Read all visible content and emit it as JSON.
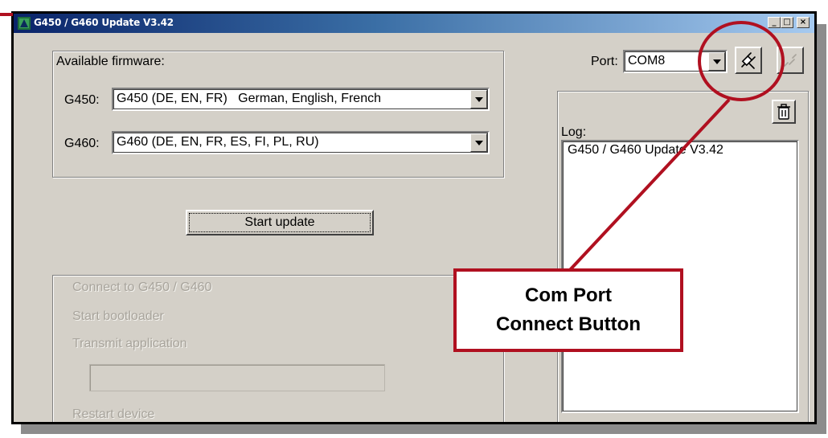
{
  "window": {
    "title": "G450 / G460 Update V3.42",
    "controls": {
      "minimize": "_",
      "maximize": "□",
      "close": "×"
    }
  },
  "firmware": {
    "group_label": "Available firmware:",
    "g450_label": "G450:",
    "g450_value": "G450 (DE, EN, FR)   German, English, French",
    "g460_label": "G460:",
    "g460_value": "G460 (DE, EN, FR, ES, FI, PL, RU)"
  },
  "actions": {
    "start_update": "Start update"
  },
  "steps": [
    "Connect to G450 / G460",
    "Start bootloader",
    "Transmit application",
    "Restart device"
  ],
  "progress": {
    "value": 0
  },
  "port": {
    "label": "Port:",
    "value": "COM8"
  },
  "log": {
    "label": "Log:",
    "lines": [
      "G450 / G460 Update V3.42"
    ]
  },
  "annotation": {
    "line1": "Com Port",
    "line2": "Connect Button",
    "color": "#b01020"
  },
  "icons": {
    "app": "app-icon",
    "connect": "plug-icon",
    "disconnect": "unplug-icon",
    "clear_log": "trash-icon"
  }
}
